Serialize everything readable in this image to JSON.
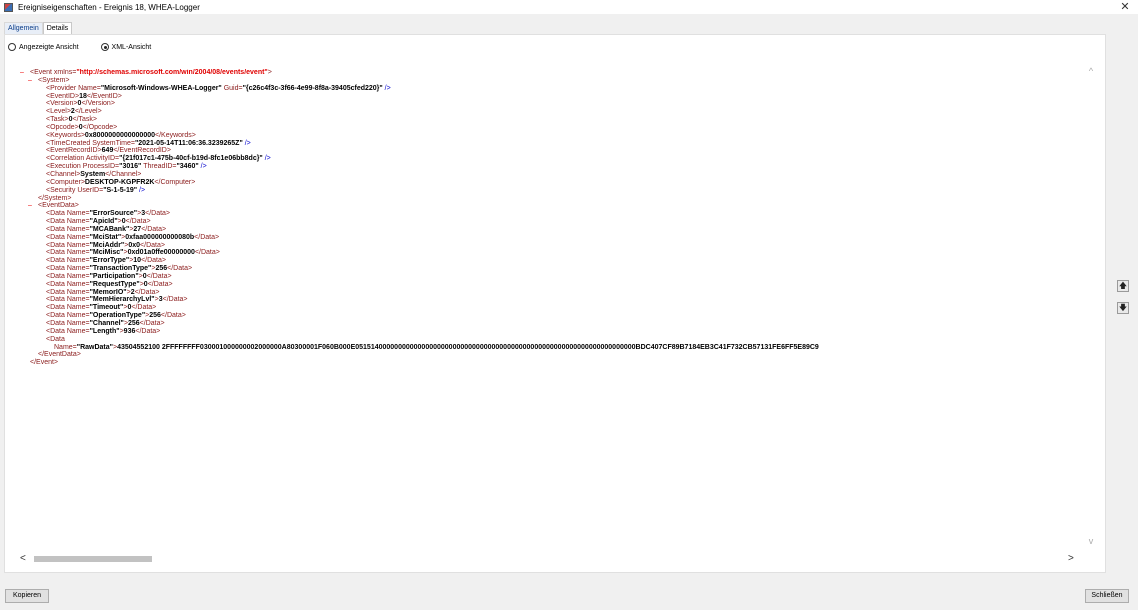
{
  "window": {
    "title": "Ereigniseigenschaften - Ereignis 18, WHEA-Logger",
    "close_glyph": "✕"
  },
  "tabs": [
    {
      "label": "Allgemein",
      "active": false
    },
    {
      "label": "Details",
      "active": true
    }
  ],
  "view_options": [
    {
      "label": "Angezeigte Ansicht",
      "checked": false
    },
    {
      "label": "XML-Ansicht",
      "checked": true
    }
  ],
  "xml": {
    "event_open": "<Event xmlns=",
    "event_ns": "\"http://schemas.microsoft.com/win/2004/08/events/event\"",
    "event_close_bracket": ">",
    "system_open": "<System>",
    "provider_prefix": "<Provider Name=",
    "provider_name": "\"Microsoft-Windows-WHEA-Logger\"",
    "provider_guid_attr": " Guid=",
    "provider_guid": "\"{c26c4f3c-3f66-4e99-8f8a-39405cfed220}\"",
    "provider_end": " />",
    "system_fields": [
      {
        "open": "<EventID>",
        "value": "18",
        "close": "</EventID>"
      },
      {
        "open": "<Version>",
        "value": "0",
        "close": "</Version>"
      },
      {
        "open": "<Level>",
        "value": "2",
        "close": "</Level>"
      },
      {
        "open": "<Task>",
        "value": "0",
        "close": "</Task>"
      },
      {
        "open": "<Opcode>",
        "value": "0",
        "close": "</Opcode>"
      },
      {
        "open": "<Keywords>",
        "value": "0x8000000000000000",
        "close": "</Keywords>"
      }
    ],
    "timecreated_prefix": "<TimeCreated SystemTime=",
    "timecreated_value": "\"2021-05-14T11:06:36.3239265Z\"",
    "timecreated_end": " />",
    "recordid_open": "<EventRecordID>",
    "recordid_value": "649",
    "recordid_close": "</EventRecordID>",
    "correlation_prefix": "<Correlation ActivityID=",
    "correlation_value": "\"{21f017c1-475b-40cf-b19d-8fc1e06bb8dc}\"",
    "correlation_end": " />",
    "execution_prefix": "<Execution ProcessID=",
    "execution_pid": "\"3016\"",
    "execution_tid_attr": " ThreadID=",
    "execution_tid": "\"3460\"",
    "execution_end": " />",
    "channel_open": "<Channel>",
    "channel_value": "System",
    "channel_close": "</Channel>",
    "computer_open": "<Computer>",
    "computer_value": "DESKTOP-KGPFR2K",
    "computer_close": "</Computer>",
    "security_prefix": "<Security UserID=",
    "security_value": "\"S-1-5-19\"",
    "security_end": " />",
    "system_close": "</System>",
    "eventdata_open": "<EventData>",
    "data_items": [
      {
        "name": "ErrorSource",
        "value": "3"
      },
      {
        "name": "ApicId",
        "value": "0"
      },
      {
        "name": "MCABank",
        "value": "27"
      },
      {
        "name": "MciStat",
        "value": "0xfaa000000000080b"
      },
      {
        "name": "MciAddr",
        "value": "0x0"
      },
      {
        "name": "MciMisc",
        "value": "0xd01a0ffe00000000"
      },
      {
        "name": "ErrorType",
        "value": "10"
      },
      {
        "name": "TransactionType",
        "value": "256"
      },
      {
        "name": "Participation",
        "value": "0"
      },
      {
        "name": "RequestType",
        "value": "0"
      },
      {
        "name": "MemorIO",
        "value": "2"
      },
      {
        "name": "MemHierarchyLvl",
        "value": "3"
      },
      {
        "name": "Timeout",
        "value": "0"
      },
      {
        "name": "OperationType",
        "value": "256"
      },
      {
        "name": "Channel",
        "value": "256"
      },
      {
        "name": "Length",
        "value": "936"
      }
    ],
    "data_prefix": "<Data Name=",
    "data_close": "</Data>",
    "rawdata_open": "<Data",
    "rawdata_attr": "Name=",
    "rawdata_name": "\"RawData\"",
    "rawdata_value": "43504552100 2FFFFFFFF030001000000002000000A80300001F060B000E051514000000000000000000000000000000000000000000000000000000000000000000BDC407CF89B7184EB3C41F732CB57131FE6FF5E89C9",
    "eventdata_close": "</EventData>",
    "event_close": "</Event>",
    "toggle_glyph": "–"
  },
  "buttons": {
    "copy": "Kopieren",
    "close": "Schließen"
  },
  "icons": {
    "scroll_up": "^",
    "scroll_down": "v",
    "scroll_left": "<",
    "scroll_right": ">",
    "nav_up": "🡅",
    "nav_down": "🡇"
  }
}
